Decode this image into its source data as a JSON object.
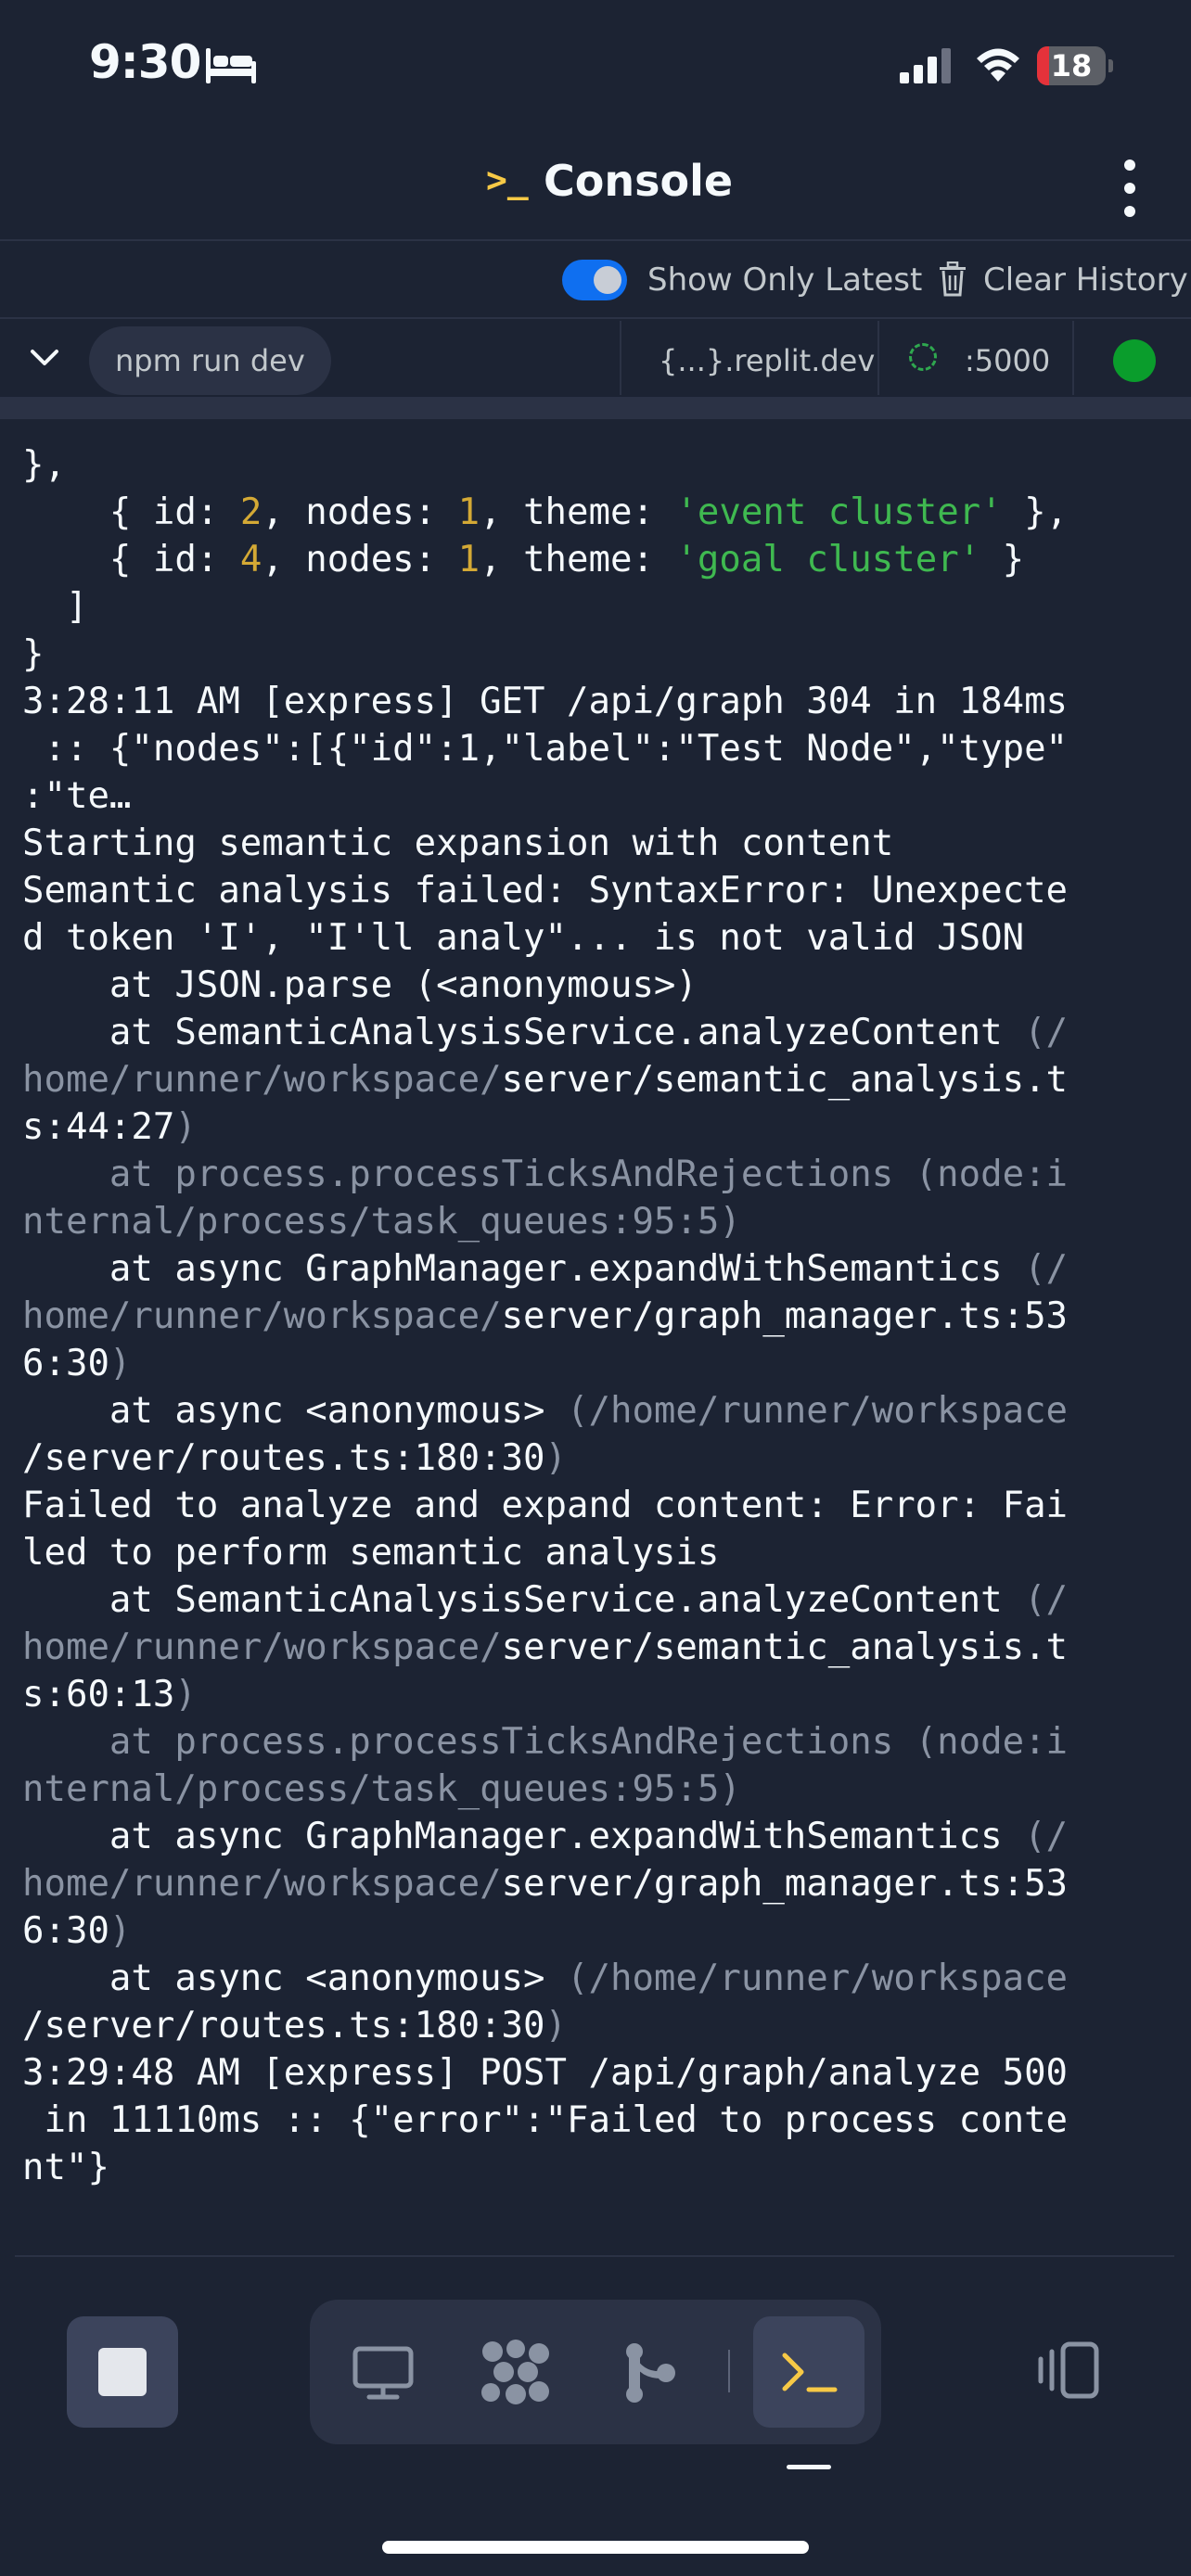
{
  "status_bar": {
    "time": "9:30",
    "battery": "18",
    "battery_level": 0.18
  },
  "header": {
    "prompt_glyph": ">_",
    "title": "Console"
  },
  "toolbar": {
    "toggle_label": "Show Only Latest",
    "toggle_on": true,
    "clear_label": "Clear History"
  },
  "tab_row": {
    "process": "npm run dev",
    "domain": "{...}.replit.dev",
    "port": ":5000"
  },
  "console": {
    "lines": [
      [
        {
          "t": "},"
        }
      ],
      [
        {
          "t": "    { id: "
        },
        {
          "t": "2",
          "c": "num"
        },
        {
          "t": ", nodes: "
        },
        {
          "t": "1",
          "c": "num"
        },
        {
          "t": ", theme: "
        },
        {
          "t": "'event cluster'",
          "c": "str"
        },
        {
          "t": " },"
        }
      ],
      [
        {
          "t": "    { id: "
        },
        {
          "t": "4",
          "c": "num"
        },
        {
          "t": ", nodes: "
        },
        {
          "t": "1",
          "c": "num"
        },
        {
          "t": ", theme: "
        },
        {
          "t": "'goal cluster'",
          "c": "str"
        },
        {
          "t": " }"
        }
      ],
      [
        {
          "t": "  ]"
        }
      ],
      [
        {
          "t": "}"
        }
      ],
      [
        {
          "t": "3:28:11 AM [express] GET /api/graph 304 in 184ms"
        }
      ],
      [
        {
          "t": " :: {\"nodes\":[{\"id\":1,\"label\":\"Test Node\",\"type\""
        }
      ],
      [
        {
          "t": ":\"te…"
        }
      ],
      [
        {
          "t": "Starting semantic expansion with content"
        }
      ],
      [
        {
          "t": "Semantic analysis failed: SyntaxError: Unexpecte"
        }
      ],
      [
        {
          "t": "d token 'I', \"I'll analy\"... is not valid JSON"
        }
      ],
      [
        {
          "t": "    at JSON.parse (<anonymous>)"
        }
      ],
      [
        {
          "t": "    at SemanticAnalysisService.analyzeContent "
        },
        {
          "t": "(/",
          "c": "dim"
        }
      ],
      [
        {
          "t": "home/runner/workspace/",
          "c": "dim"
        },
        {
          "t": "server/semantic_analysis.t"
        }
      ],
      [
        {
          "t": "s:44:27"
        },
        {
          "t": ")",
          "c": "dim"
        }
      ],
      [
        {
          "t": "    at process.processTicksAndRejections (node:i",
          "c": "dim"
        }
      ],
      [
        {
          "t": "nternal/process/task_queues:95:5)",
          "c": "dim"
        }
      ],
      [
        {
          "t": "    at async GraphManager.expandWithSemantics "
        },
        {
          "t": "(/",
          "c": "dim"
        }
      ],
      [
        {
          "t": "home/runner/workspace/",
          "c": "dim"
        },
        {
          "t": "server/graph_manager.ts:53"
        }
      ],
      [
        {
          "t": "6:30"
        },
        {
          "t": ")",
          "c": "dim"
        }
      ],
      [
        {
          "t": "    at async <anonymous> "
        },
        {
          "t": "(/home/runner/workspace",
          "c": "dim"
        }
      ],
      [
        {
          "t": "/server/routes.ts:180:30"
        },
        {
          "t": ")",
          "c": "dim"
        }
      ],
      [
        {
          "t": "Failed to analyze and expand content: Error: Fai"
        }
      ],
      [
        {
          "t": "led to perform semantic analysis"
        }
      ],
      [
        {
          "t": "    at SemanticAnalysisService.analyzeContent "
        },
        {
          "t": "(/",
          "c": "dim"
        }
      ],
      [
        {
          "t": "home/runner/workspace/",
          "c": "dim"
        },
        {
          "t": "server/semantic_analysis.t"
        }
      ],
      [
        {
          "t": "s:60:13"
        },
        {
          "t": ")",
          "c": "dim"
        }
      ],
      [
        {
          "t": "    at process.processTicksAndRejections (node:i",
          "c": "dim"
        }
      ],
      [
        {
          "t": "nternal/process/task_queues:95:5)",
          "c": "dim"
        }
      ],
      [
        {
          "t": "    at async GraphManager.expandWithSemantics "
        },
        {
          "t": "(/",
          "c": "dim"
        }
      ],
      [
        {
          "t": "home/runner/workspace/",
          "c": "dim"
        },
        {
          "t": "server/graph_manager.ts:53"
        }
      ],
      [
        {
          "t": "6:30"
        },
        {
          "t": ")",
          "c": "dim"
        }
      ],
      [
        {
          "t": "    at async <anonymous> "
        },
        {
          "t": "(/home/runner/workspace",
          "c": "dim"
        }
      ],
      [
        {
          "t": "/server/routes.ts:180:30"
        },
        {
          "t": ")",
          "c": "dim"
        }
      ],
      [
        {
          "t": "3:29:48 AM [express] POST /api/graph/analyze 500"
        }
      ],
      [
        {
          "t": " in 11110ms :: {\"error\":\"Failed to process conte"
        }
      ],
      [
        {
          "t": "nt\"}"
        }
      ]
    ]
  },
  "bottom_bar": {
    "stop_icon": "stop-square-icon",
    "tools": [
      "monitor-icon",
      "packages-icon",
      "git-icon",
      "console-prompt-icon"
    ],
    "right_icon": "device-switch-icon"
  },
  "colors": {
    "background": "#1c2333",
    "accent": "#0f6ff0",
    "prompt": "#f7c946",
    "string": "#3fb950",
    "number": "#d4a935",
    "status_ok": "#0a9d2c"
  }
}
